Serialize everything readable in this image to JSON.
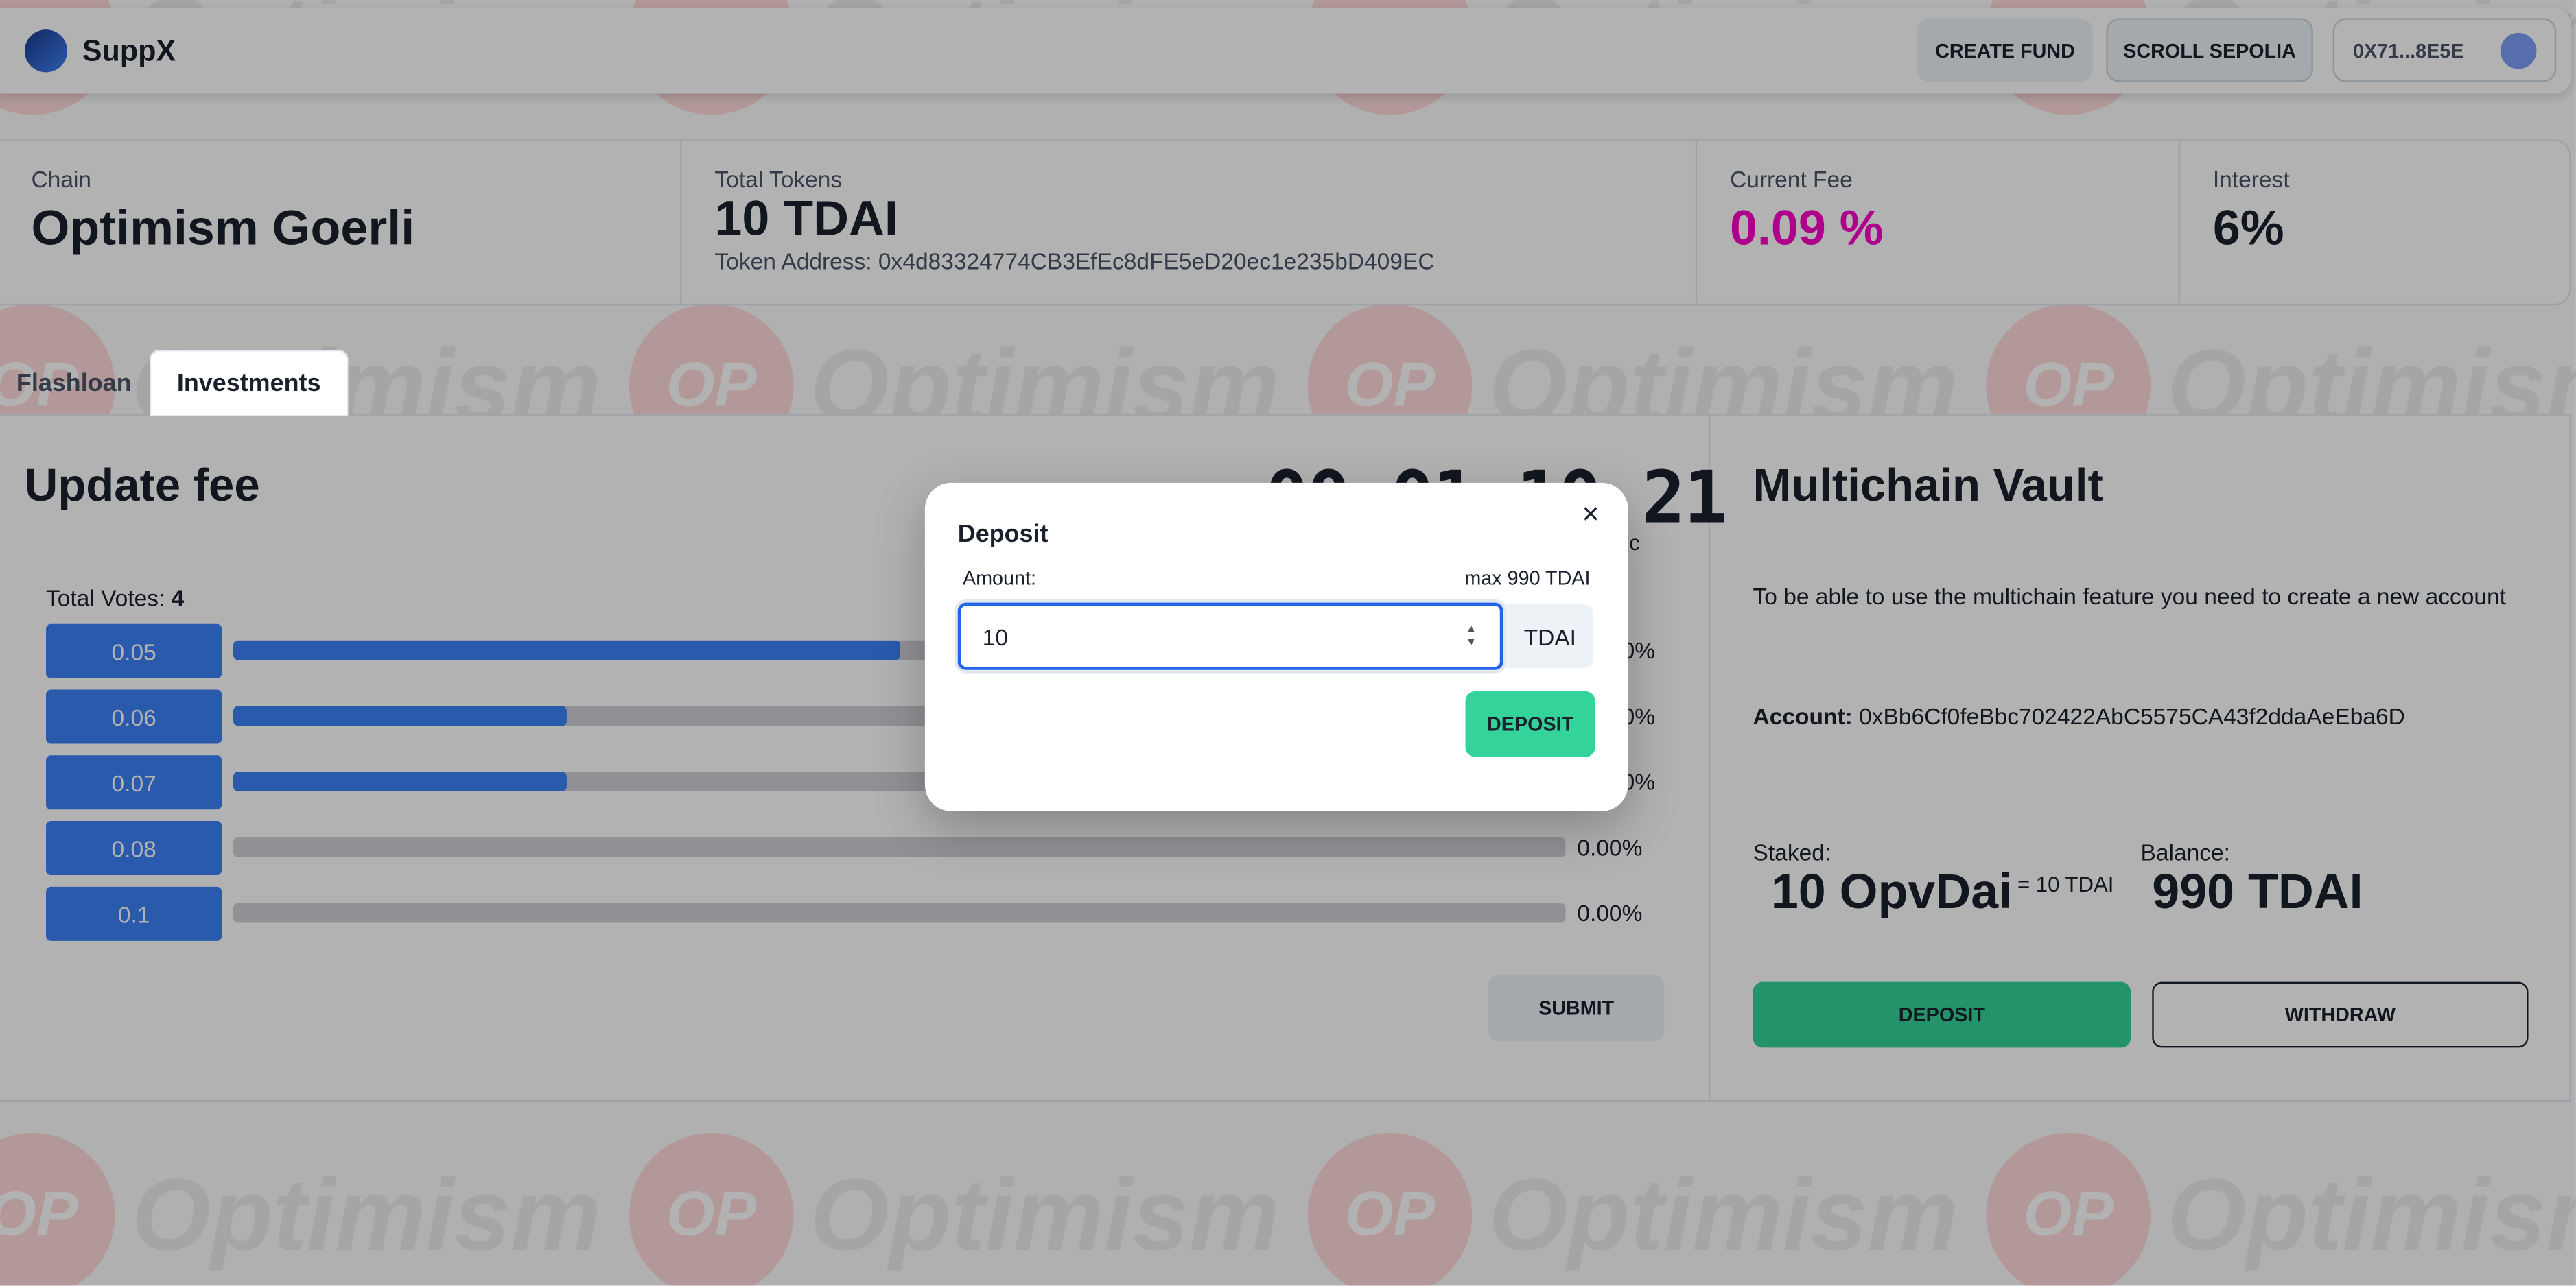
{
  "watermark": {
    "word": "Optimism",
    "badge": "OP"
  },
  "header": {
    "brand": "SuppX",
    "buttons": {
      "create_fund": "CREATE FUND",
      "network": "SCROLL SEPOLIA",
      "account": "0X71...8E5E"
    }
  },
  "stats": {
    "chain": {
      "label": "Chain",
      "value": "Optimism Goerli"
    },
    "total_tokens": {
      "label": "Total Tokens",
      "value": "10 TDAI",
      "token_address": "Token Address: 0x4d83324774CB3EfEc8dFE5eD20ec1e235bD409EC"
    },
    "current_fee": {
      "label": "Current Fee",
      "value": "0.09 %",
      "color": "#f900c8"
    },
    "interest": {
      "label": "Interest",
      "value": "6%"
    }
  },
  "tabs": [
    {
      "label": "Flashloan",
      "active": false
    },
    {
      "label": "Investments",
      "active": true
    }
  ],
  "update_fee": {
    "title": "Update fee",
    "timer": {
      "days": "00",
      "hours": "01",
      "minutes": "10",
      "seconds": "21",
      "sec_label": "sec"
    },
    "total_votes_label": "Total Votes:",
    "total_votes": "4",
    "options": [
      {
        "fee": "0.05",
        "share": 0.5,
        "pct": "50.00%"
      },
      {
        "fee": "0.06",
        "share": 0.25,
        "pct": "25.00%"
      },
      {
        "fee": "0.07",
        "share": 0.25,
        "pct": "25.00%"
      },
      {
        "fee": "0.08",
        "share": 0,
        "pct": "0.00%"
      },
      {
        "fee": "0.1",
        "share": 0,
        "pct": "0.00%"
      }
    ],
    "submit": "SUBMIT"
  },
  "vault": {
    "title": "Multichain Vault",
    "info": "To be able to use the multichain feature you need to create a new account",
    "account_label": "Account:",
    "account": "0xBb6Cf0feBbc702422AbC5575CA43f2ddaAeEba6D",
    "staked_label": "Staked:",
    "staked": "10 OpvDai",
    "staked_equiv": "= 10 TDAI",
    "balance_label": "Balance:",
    "balance": "990 TDAI",
    "deposit": "DEPOSIT",
    "withdraw": "WITHDRAW"
  },
  "modal": {
    "title": "Deposit",
    "close": "×",
    "amount_label": "Amount:",
    "max": "max 990 TDAI",
    "amount_value": "10",
    "unit": "TDAI",
    "deposit": "DEPOSIT"
  },
  "colors": {
    "accent_blue": "#3b82f6",
    "green": "#34d399",
    "fee": "#f900c8"
  }
}
